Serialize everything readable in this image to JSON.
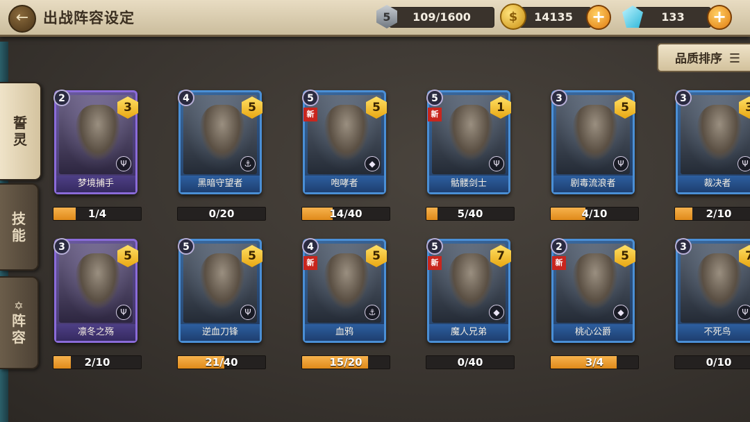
{
  "header": {
    "back_icon": "back-arrow-icon",
    "title": "出战阵容设定",
    "stamina": {
      "level": "5",
      "value": "109/1600"
    },
    "gold": {
      "value": "14135"
    },
    "gems": {
      "value": "133"
    },
    "plus": "+"
  },
  "side_tabs": [
    {
      "label_1": "誓",
      "label_2": "灵",
      "active": true
    },
    {
      "label_1": "技",
      "label_2": "能",
      "active": false
    },
    {
      "label_1": "阵",
      "label_2": "容",
      "active": false
    }
  ],
  "sort_button": {
    "label": "品质排序",
    "icon": "list-icon"
  },
  "heroes": [
    {
      "name": "梦境捕手",
      "level": "2",
      "stars": "3",
      "is_new": false,
      "rarity": "purple",
      "progress_text": "1/4",
      "progress_fraction": 0.25
    },
    {
      "name": "黑暗守望者",
      "level": "4",
      "stars": "5",
      "is_new": false,
      "rarity": "blue",
      "progress_text": "0/20",
      "progress_fraction": 0.0
    },
    {
      "name": "咆哮者",
      "level": "5",
      "stars": "5",
      "is_new": true,
      "rarity": "blue",
      "progress_text": "14/40",
      "progress_fraction": 0.35
    },
    {
      "name": "骷髅剑士",
      "level": "5",
      "stars": "1",
      "is_new": true,
      "rarity": "blue",
      "progress_text": "5/40",
      "progress_fraction": 0.125
    },
    {
      "name": "剧毒流浪者",
      "level": "3",
      "stars": "5",
      "is_new": false,
      "rarity": "blue",
      "progress_text": "4/10",
      "progress_fraction": 0.4
    },
    {
      "name": "裁决者",
      "level": "3",
      "stars": "3",
      "is_new": false,
      "rarity": "blue",
      "progress_text": "2/10",
      "progress_fraction": 0.2
    },
    {
      "name": "凛冬之殇",
      "level": "3",
      "stars": "5",
      "is_new": false,
      "rarity": "purple",
      "progress_text": "2/10",
      "progress_fraction": 0.2
    },
    {
      "name": "逆血刀锋",
      "level": "5",
      "stars": "5",
      "is_new": false,
      "rarity": "blue",
      "progress_text": "21/40",
      "progress_fraction": 0.525
    },
    {
      "name": "血鸦",
      "level": "4",
      "stars": "5",
      "is_new": true,
      "rarity": "blue",
      "progress_text": "15/20",
      "progress_fraction": 0.75
    },
    {
      "name": "魔人兄弟",
      "level": "5",
      "stars": "7",
      "is_new": true,
      "rarity": "blue",
      "progress_text": "0/40",
      "progress_fraction": 0.0
    },
    {
      "name": "桃心公爵",
      "level": "2",
      "stars": "5",
      "is_new": true,
      "rarity": "blue",
      "progress_text": "3/4",
      "progress_fraction": 0.75
    },
    {
      "name": "不死鸟",
      "level": "3",
      "stars": "7",
      "is_new": false,
      "rarity": "blue",
      "progress_text": "0/10",
      "progress_fraction": 0.0
    }
  ],
  "labels": {
    "new_tag": "新"
  }
}
